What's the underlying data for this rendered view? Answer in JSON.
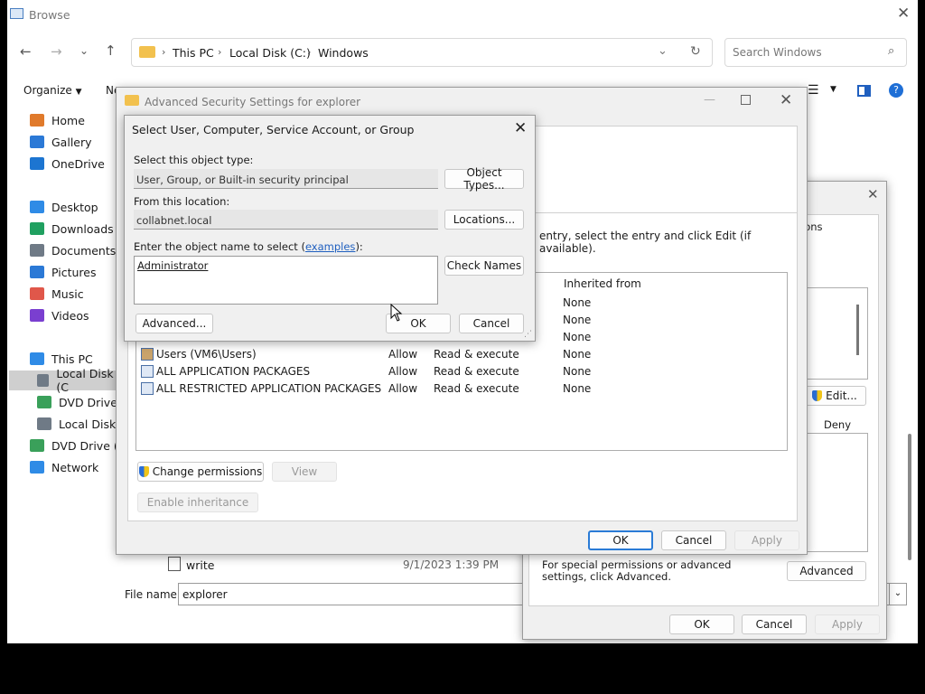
{
  "browse": {
    "title": "Browse",
    "address": [
      "This PC",
      "Local Disk (C:)",
      "Windows"
    ],
    "search_placeholder": "Search Windows",
    "organize_label": "Organize",
    "new_folder_partial": "Ne",
    "sidebar": [
      {
        "label": "Home",
        "icon": "home-icon",
        "color": "#e07a2b"
      },
      {
        "label": "Gallery",
        "icon": "gallery-icon",
        "color": "#2b79d6"
      },
      {
        "label": "OneDrive",
        "icon": "onedrive-icon",
        "color": "#1d75d1"
      },
      {
        "label": "Desktop",
        "icon": "desktop-icon",
        "color": "#2f8be6"
      },
      {
        "label": "Downloads",
        "icon": "downloads-icon",
        "color": "#20a060"
      },
      {
        "label": "Documents",
        "icon": "documents-icon",
        "color": "#6f7a86"
      },
      {
        "label": "Pictures",
        "icon": "pictures-icon",
        "color": "#2b79d6"
      },
      {
        "label": "Music",
        "icon": "music-icon",
        "color": "#e0574a"
      },
      {
        "label": "Videos",
        "icon": "videos-icon",
        "color": "#7a3fd0"
      },
      {
        "label": "This PC",
        "icon": "this-pc-icon",
        "color": "#2f8be6"
      },
      {
        "label": "Local Disk (C",
        "icon": "drive-icon",
        "color": "#6f7a86"
      },
      {
        "label": "DVD Drive (E",
        "icon": "dvd-icon",
        "color": "#3aa05a"
      },
      {
        "label": "Local Disk (F",
        "icon": "drive-icon",
        "color": "#6f7a86"
      },
      {
        "label": "DVD Drive (E:)",
        "icon": "dvd-icon",
        "color": "#3aa05a"
      },
      {
        "label": "Network",
        "icon": "network-icon",
        "color": "#2f8be6"
      }
    ],
    "file_row": {
      "name": "write",
      "date": "9/1/2023 1:39 PM"
    },
    "filename_label": "File name:",
    "filename_value": "explorer"
  },
  "adv": {
    "title": "Advanced Security Settings for explorer",
    "instruction": "entry, select the entry and click Edit (if available).",
    "col_inherited": "Inherited from",
    "rows": [
      {
        "principal": "",
        "type": "",
        "access": "",
        "inherited": "None"
      },
      {
        "principal": "",
        "type": "",
        "access": "",
        "inherited": "None"
      },
      {
        "principal": "",
        "type": "",
        "access": "",
        "inherited": "None"
      },
      {
        "principal": "Users (VM6\\Users)",
        "type": "Allow",
        "access": "Read & execute",
        "inherited": "None"
      },
      {
        "principal": "ALL APPLICATION PACKAGES",
        "type": "Allow",
        "access": "Read & execute",
        "inherited": "None"
      },
      {
        "principal": "ALL RESTRICTED APPLICATION PACKAGES",
        "type": "Allow",
        "access": "Read & execute",
        "inherited": "None"
      }
    ],
    "change_permissions": "Change permissions",
    "view": "View",
    "enable_inheritance": "Enable inheritance",
    "ok": "OK",
    "cancel": "Cancel",
    "apply": "Apply"
  },
  "props": {
    "tab_partial": "ions",
    "edit": "Edit...",
    "deny": "Deny",
    "special_text": "For special permissions or advanced settings, click Advanced.",
    "advanced": "Advanced",
    "ok": "OK",
    "cancel": "Cancel",
    "apply": "Apply"
  },
  "select": {
    "title": "Select User, Computer, Service Account, or Group",
    "object_type_label": "Select this object type:",
    "object_type_value": "User, Group, or Built-in security principal",
    "object_types_btn": "Object Types...",
    "location_label": "From this location:",
    "location_value": "collabnet.local",
    "locations_btn": "Locations...",
    "enter_label_pre": "Enter the object name to select (",
    "examples": "examples",
    "enter_label_post": "):",
    "object_name": "Administrator",
    "check_names": "Check Names",
    "advanced": "Advanced...",
    "ok": "OK",
    "cancel": "Cancel"
  }
}
